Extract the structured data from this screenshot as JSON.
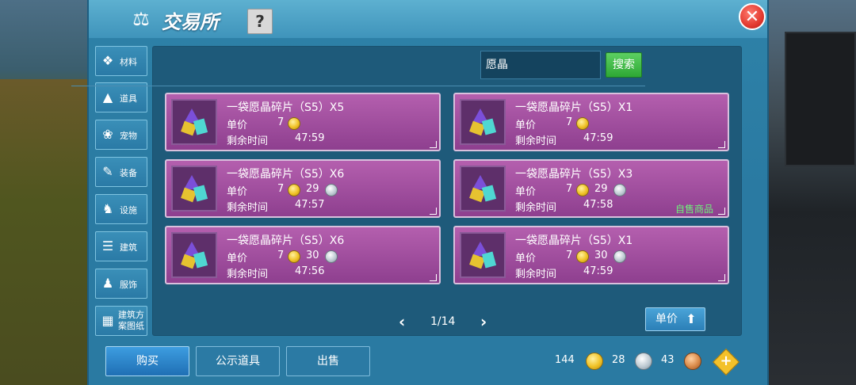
{
  "title": "交易所",
  "help_label": "?",
  "close_label": "✕",
  "sidebar": {
    "items": [
      {
        "label": "材料",
        "icon": "ore-icon"
      },
      {
        "label": "道具",
        "icon": "item-icon"
      },
      {
        "label": "宠物",
        "icon": "paw-icon"
      },
      {
        "label": "装备",
        "icon": "equipment-icon"
      },
      {
        "label": "设施",
        "icon": "facility-icon"
      },
      {
        "label": "建筑",
        "icon": "building-icon"
      },
      {
        "label": "服饰",
        "icon": "clothing-icon"
      },
      {
        "label": "建筑方案图纸",
        "icon": "blueprint-icon"
      }
    ]
  },
  "search": {
    "value": "愿晶",
    "button": "搜索"
  },
  "labels": {
    "unit_price": "单价",
    "time_left": "剩余时间",
    "own_item": "自售商品"
  },
  "listings": [
    {
      "name": "一袋愿晶碎片（S5）X5",
      "gold": "7",
      "silver": "",
      "time": "47:59",
      "own": false
    },
    {
      "name": "一袋愿晶碎片（S5）X1",
      "gold": "7",
      "silver": "",
      "time": "47:59",
      "own": false
    },
    {
      "name": "一袋愿晶碎片（S5）X6",
      "gold": "7",
      "silver": "29",
      "time": "47:57",
      "own": false
    },
    {
      "name": "一袋愿晶碎片（S5）X3",
      "gold": "7",
      "silver": "29",
      "time": "47:58",
      "own": true
    },
    {
      "name": "一袋愿晶碎片（S5）X6",
      "gold": "7",
      "silver": "30",
      "time": "47:56",
      "own": false
    },
    {
      "name": "一袋愿晶碎片（S5）X1",
      "gold": "7",
      "silver": "30",
      "time": "47:59",
      "own": false
    }
  ],
  "pager": {
    "text": "1/14"
  },
  "sort": {
    "label": "单价"
  },
  "bottom": {
    "buy": "购买",
    "public": "公示道具",
    "sell": "出售"
  },
  "currency": {
    "gold": "144",
    "silver": "28",
    "copper": "43"
  },
  "colors": {
    "panel": "#2a7aa2",
    "card": "#a04f9f",
    "own_text": "#6ff07a",
    "buy_button": "#2b85cc"
  }
}
